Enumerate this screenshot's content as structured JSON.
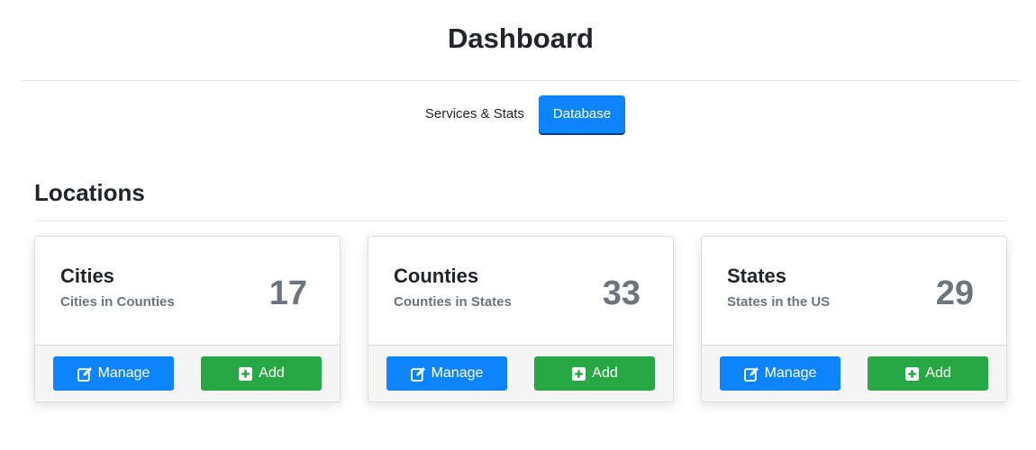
{
  "header": {
    "title": "Dashboard"
  },
  "nav": {
    "items": [
      {
        "label": "Services & Stats",
        "active": false
      },
      {
        "label": "Database",
        "active": true
      }
    ]
  },
  "section": {
    "title": "Locations"
  },
  "cards": [
    {
      "title": "Cities",
      "subtitle": "Cities in Counties",
      "count": "17",
      "manage_label": "Manage",
      "add_label": "Add"
    },
    {
      "title": "Counties",
      "subtitle": "Counties in States",
      "count": "33",
      "manage_label": "Manage",
      "add_label": "Add"
    },
    {
      "title": "States",
      "subtitle": "States in the US",
      "count": "29",
      "manage_label": "Manage",
      "add_label": "Add"
    }
  ],
  "icons": {
    "manage": "edit-icon",
    "add": "plus-square-icon"
  },
  "colors": {
    "primary": "#0d84ff",
    "success": "#28a745",
    "muted": "#6c757d"
  }
}
